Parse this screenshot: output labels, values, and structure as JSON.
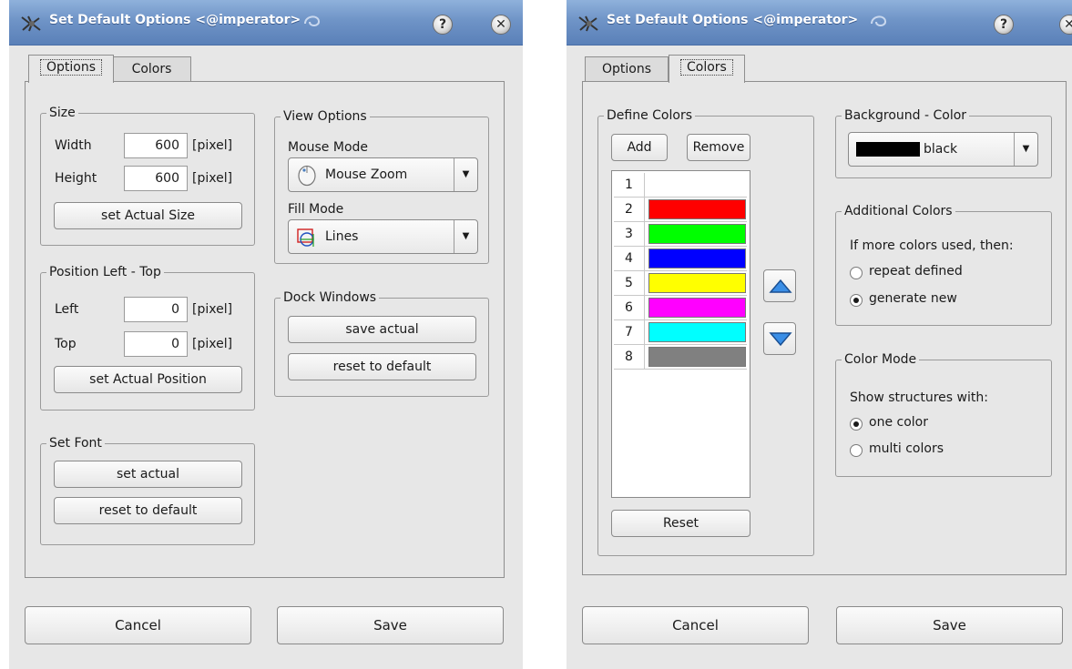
{
  "window": {
    "title": "Set Default Options <@imperator>",
    "help_label": "?",
    "close_label": "✕"
  },
  "tabs": {
    "options": "Options",
    "colors": "Colors"
  },
  "options_tab": {
    "size": {
      "legend": "Size",
      "width_label": "Width",
      "width_value": "600",
      "height_label": "Height",
      "height_value": "600",
      "unit": "[pixel]",
      "set_button": "set Actual Size"
    },
    "position": {
      "legend": "Position Left - Top",
      "left_label": "Left",
      "left_value": "0",
      "top_label": "Top",
      "top_value": "0",
      "unit": "[pixel]",
      "set_button": "set Actual Position"
    },
    "font": {
      "legend": "Set Font",
      "set_actual": "set actual",
      "reset": "reset to default"
    },
    "view": {
      "legend": "View Options",
      "mouse_mode_label": "Mouse Mode",
      "mouse_mode_value": "Mouse Zoom",
      "fill_mode_label": "Fill Mode",
      "fill_mode_value": "Lines"
    },
    "dock": {
      "legend": "Dock Windows",
      "save": "save actual",
      "reset": "reset to default"
    }
  },
  "colors_tab": {
    "define": {
      "legend": "Define Colors",
      "add": "Add",
      "remove": "Remove",
      "reset": "Reset",
      "rows": [
        {
          "num": "1",
          "color": "#ffffff"
        },
        {
          "num": "2",
          "color": "#ff0000"
        },
        {
          "num": "3",
          "color": "#00ff00"
        },
        {
          "num": "4",
          "color": "#0000ff"
        },
        {
          "num": "5",
          "color": "#ffff00"
        },
        {
          "num": "6",
          "color": "#ff00ff"
        },
        {
          "num": "7",
          "color": "#00ffff"
        },
        {
          "num": "8",
          "color": "#808080"
        }
      ]
    },
    "background": {
      "legend": "Background - Color",
      "value": "black",
      "swatch": "#000000"
    },
    "additional": {
      "legend": "Additional Colors",
      "prompt": "If more colors used, then:",
      "opt1": "repeat defined",
      "opt2": "generate new",
      "selected": "generate new"
    },
    "mode": {
      "legend": "Color Mode",
      "prompt": "Show structures with:",
      "opt1": "one color",
      "opt2": "multi colors",
      "selected": "one color"
    }
  },
  "footer": {
    "cancel": "Cancel",
    "save": "Save"
  },
  "colors": {
    "titlebar": "#6f94c7",
    "window_bg": "#e7e7e7",
    "arrow_blue": "#2d7fd8"
  }
}
